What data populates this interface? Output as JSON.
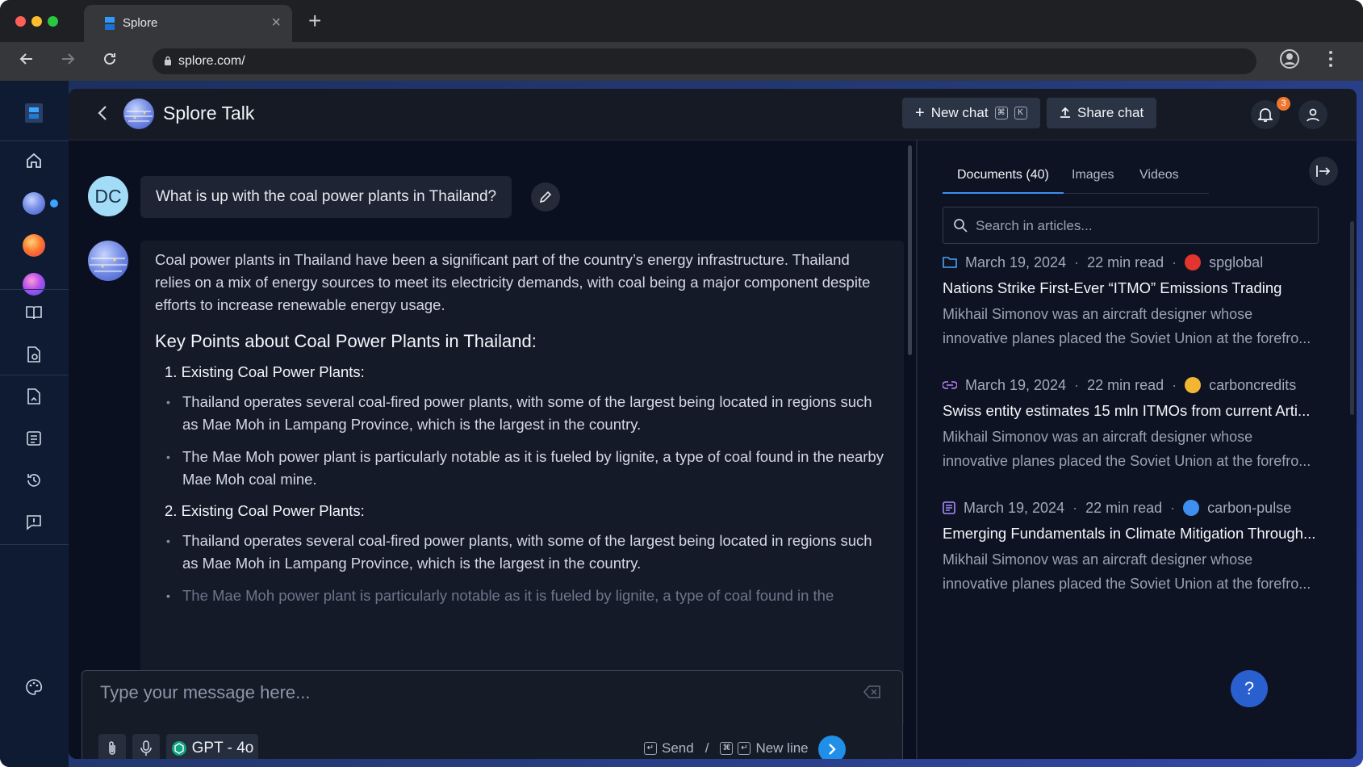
{
  "browser": {
    "tab_title": "Splore",
    "url": "splore.com/",
    "new_tab_symbol": "+",
    "close_symbol": "×"
  },
  "header": {
    "title": "Splore Talk",
    "new_chat_label": "New chat",
    "shortcut_cmd": "⌘",
    "shortcut_key": "K",
    "share_chat_label": "Share chat",
    "notification_count": "3"
  },
  "chat": {
    "user_initials": "DC",
    "user_message": "What is up with the coal power plants in Thailand?",
    "answer": {
      "intro": "Coal power plants in Thailand have been a significant part of the country’s energy infrastructure. Thailand relies on a mix of energy sources to meet its electricity demands, with coal being a major component despite efforts to increase renewable energy usage.",
      "heading": "Key Points about Coal Power Plants in Thailand:",
      "sections": [
        {
          "title": "1.  Existing Coal Power Plants:",
          "bullets": [
            "Thailand operates several coal-fired power plants, with some of the largest being located in regions such as Mae Moh in Lampang Province, which is the largest in the country.",
            "The Mae Moh power plant is particularly notable as it is fueled by lignite, a type of coal found in the nearby Mae Moh coal mine."
          ]
        },
        {
          "title": "2.  Existing Coal Power Plants:",
          "bullets": [
            "Thailand operates several coal-fired power plants, with some of the largest being located in regions such as Mae Moh in Lampang Province, which is the largest in the country.",
            "The Mae Moh power plant is particularly notable as it is fueled by lignite, a type of coal found in the"
          ]
        }
      ]
    }
  },
  "composer": {
    "placeholder": "Type your message here...",
    "model_label": "GPT - 4o",
    "send_label": "Send",
    "slash": "/",
    "newline_label": "New line",
    "enter_symbol": "↵",
    "cmd_symbol": "⌘"
  },
  "panel": {
    "tabs": [
      "Documents (40)",
      "Images",
      "Videos"
    ],
    "search_placeholder": "Search in articles...",
    "dot": "·",
    "articles": [
      {
        "date": "March 19, 2024",
        "read_time": "22 min read",
        "source": "spglobal",
        "title": "Nations Strike First-Ever “ITMO” Emissions Trading",
        "desc": "Mikhail Simonov was an aircraft designer whose innovative planes placed the Soviet Union at the forefro...",
        "source_color": "#e3342f",
        "type_icon": "folder-icon"
      },
      {
        "date": "March 19, 2024",
        "read_time": "22 min read",
        "source": "carboncredits",
        "title": "Swiss entity estimates 15 mln ITMOs from current Arti...",
        "desc": "Mikhail Simonov was an aircraft designer whose innovative planes placed the Soviet Union at the forefro...",
        "source_color": "#f2b632",
        "type_icon": "link-icon"
      },
      {
        "date": "March 19, 2024",
        "read_time": "22 min read",
        "source": "carbon-pulse",
        "title": "Emerging Fundamentals in Climate Mitigation Through...",
        "desc": "Mikhail Simonov was an aircraft designer whose innovative planes placed the Soviet Union at the forefro...",
        "source_color": "#3f8ff0",
        "type_icon": "document-icon"
      }
    ]
  },
  "help_label": "?",
  "colors": {
    "accent": "#1f8fe8",
    "badge": "#f0762d",
    "app_gradient_end": "#3248a8"
  }
}
